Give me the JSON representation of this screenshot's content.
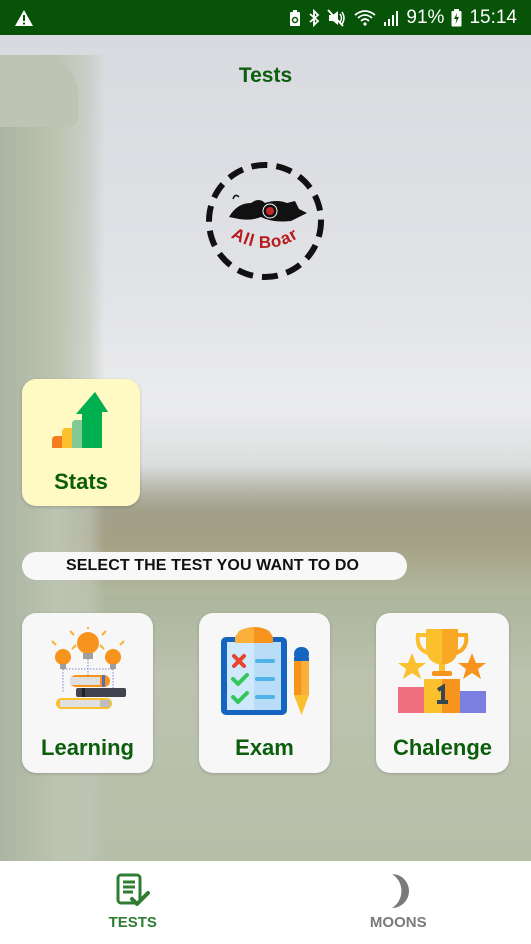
{
  "status_bar": {
    "warning_icon": "warning-triangle-icon",
    "icons": [
      "battery-saver-icon",
      "bluetooth-icon",
      "mute-icon",
      "wifi-icon",
      "signal-icon"
    ],
    "battery_percent": "91%",
    "battery_icon": "battery-charging-icon",
    "time": "15:14",
    "color": "#075307"
  },
  "header": {
    "title": "Tests"
  },
  "logo": {
    "text": "All Boar"
  },
  "stats_card": {
    "label": "Stats",
    "icon": "bar-chart-growth-icon"
  },
  "prompt": {
    "text": "SELECT THE TEST YOU WANT TO DO"
  },
  "tests": [
    {
      "label": "Learning",
      "icon": "lightbulbs-books-icon"
    },
    {
      "label": "Exam",
      "icon": "clipboard-checklist-icon"
    },
    {
      "label": "Chalenge",
      "icon": "trophy-podium-icon"
    }
  ],
  "bottom_nav": {
    "items": [
      {
        "label": "TESTS",
        "icon": "checklist-icon",
        "active": true
      },
      {
        "label": "MOONS",
        "icon": "moon-icon",
        "active": false
      }
    ]
  },
  "colors": {
    "title_green": "#0b5e0b",
    "active_tab": "#2e7d32",
    "inactive_tab": "#7a7a7a",
    "stats_bg": "#fff9c4",
    "logo_red": "#b71c1c"
  }
}
